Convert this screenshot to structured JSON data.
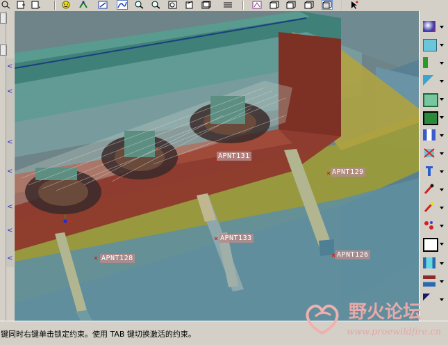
{
  "toolbar": {
    "buttons": [
      "zoom-fit-icon",
      "view-icon",
      "view-menu-icon",
      "smiley-icon",
      "spin-icon",
      "shade-icon",
      "datum-curve-icon",
      "zoom-in-icon",
      "zoom-out-icon",
      "refit-icon",
      "orient-icon",
      "saved-views-icon",
      "layers-icon",
      "model-tree-icon",
      "datum-display-icon",
      "hidden-line-icon",
      "no-hidden-icon",
      "shaded-icon",
      "select-arrow-icon"
    ]
  },
  "left_strip": {
    "markers": [
      "<",
      "<",
      "<",
      "<",
      "<",
      "<",
      "<"
    ]
  },
  "right_toolbar": {
    "buttons": [
      "mold-cavity-icon",
      "mold-layout-icon",
      "runner-icon",
      "gate-icon",
      "parting-surface-icon",
      "volume-split-icon",
      "extract-icon",
      "delete-component-icon",
      "ejector-pin-icon",
      "water-line-icon",
      "sprue-icon",
      "fill-icon",
      "mold-base-icon",
      "open-mold-icon",
      "assembly-icon",
      "drawing-icon"
    ]
  },
  "annotations": {
    "apnt131": "APNT131",
    "apnt129": "APNT129",
    "apnt133": "APNT133",
    "apnt128": "APNT128",
    "apnt126": "APNT126"
  },
  "status": {
    "message": "键同时右键单击锁定约束。使用 TAB 键切换激活的约束。"
  },
  "watermark": {
    "title": "野火论坛",
    "url": "www.proewildfire.cn"
  },
  "colors": {
    "background": "#6f8489",
    "mold_red": "#8e3a2c",
    "mold_yellow": "#9a9a3a",
    "mold_teal": "#2f7a6a",
    "mold_blue": "#6c8f9e",
    "pin": "#b2b690"
  }
}
